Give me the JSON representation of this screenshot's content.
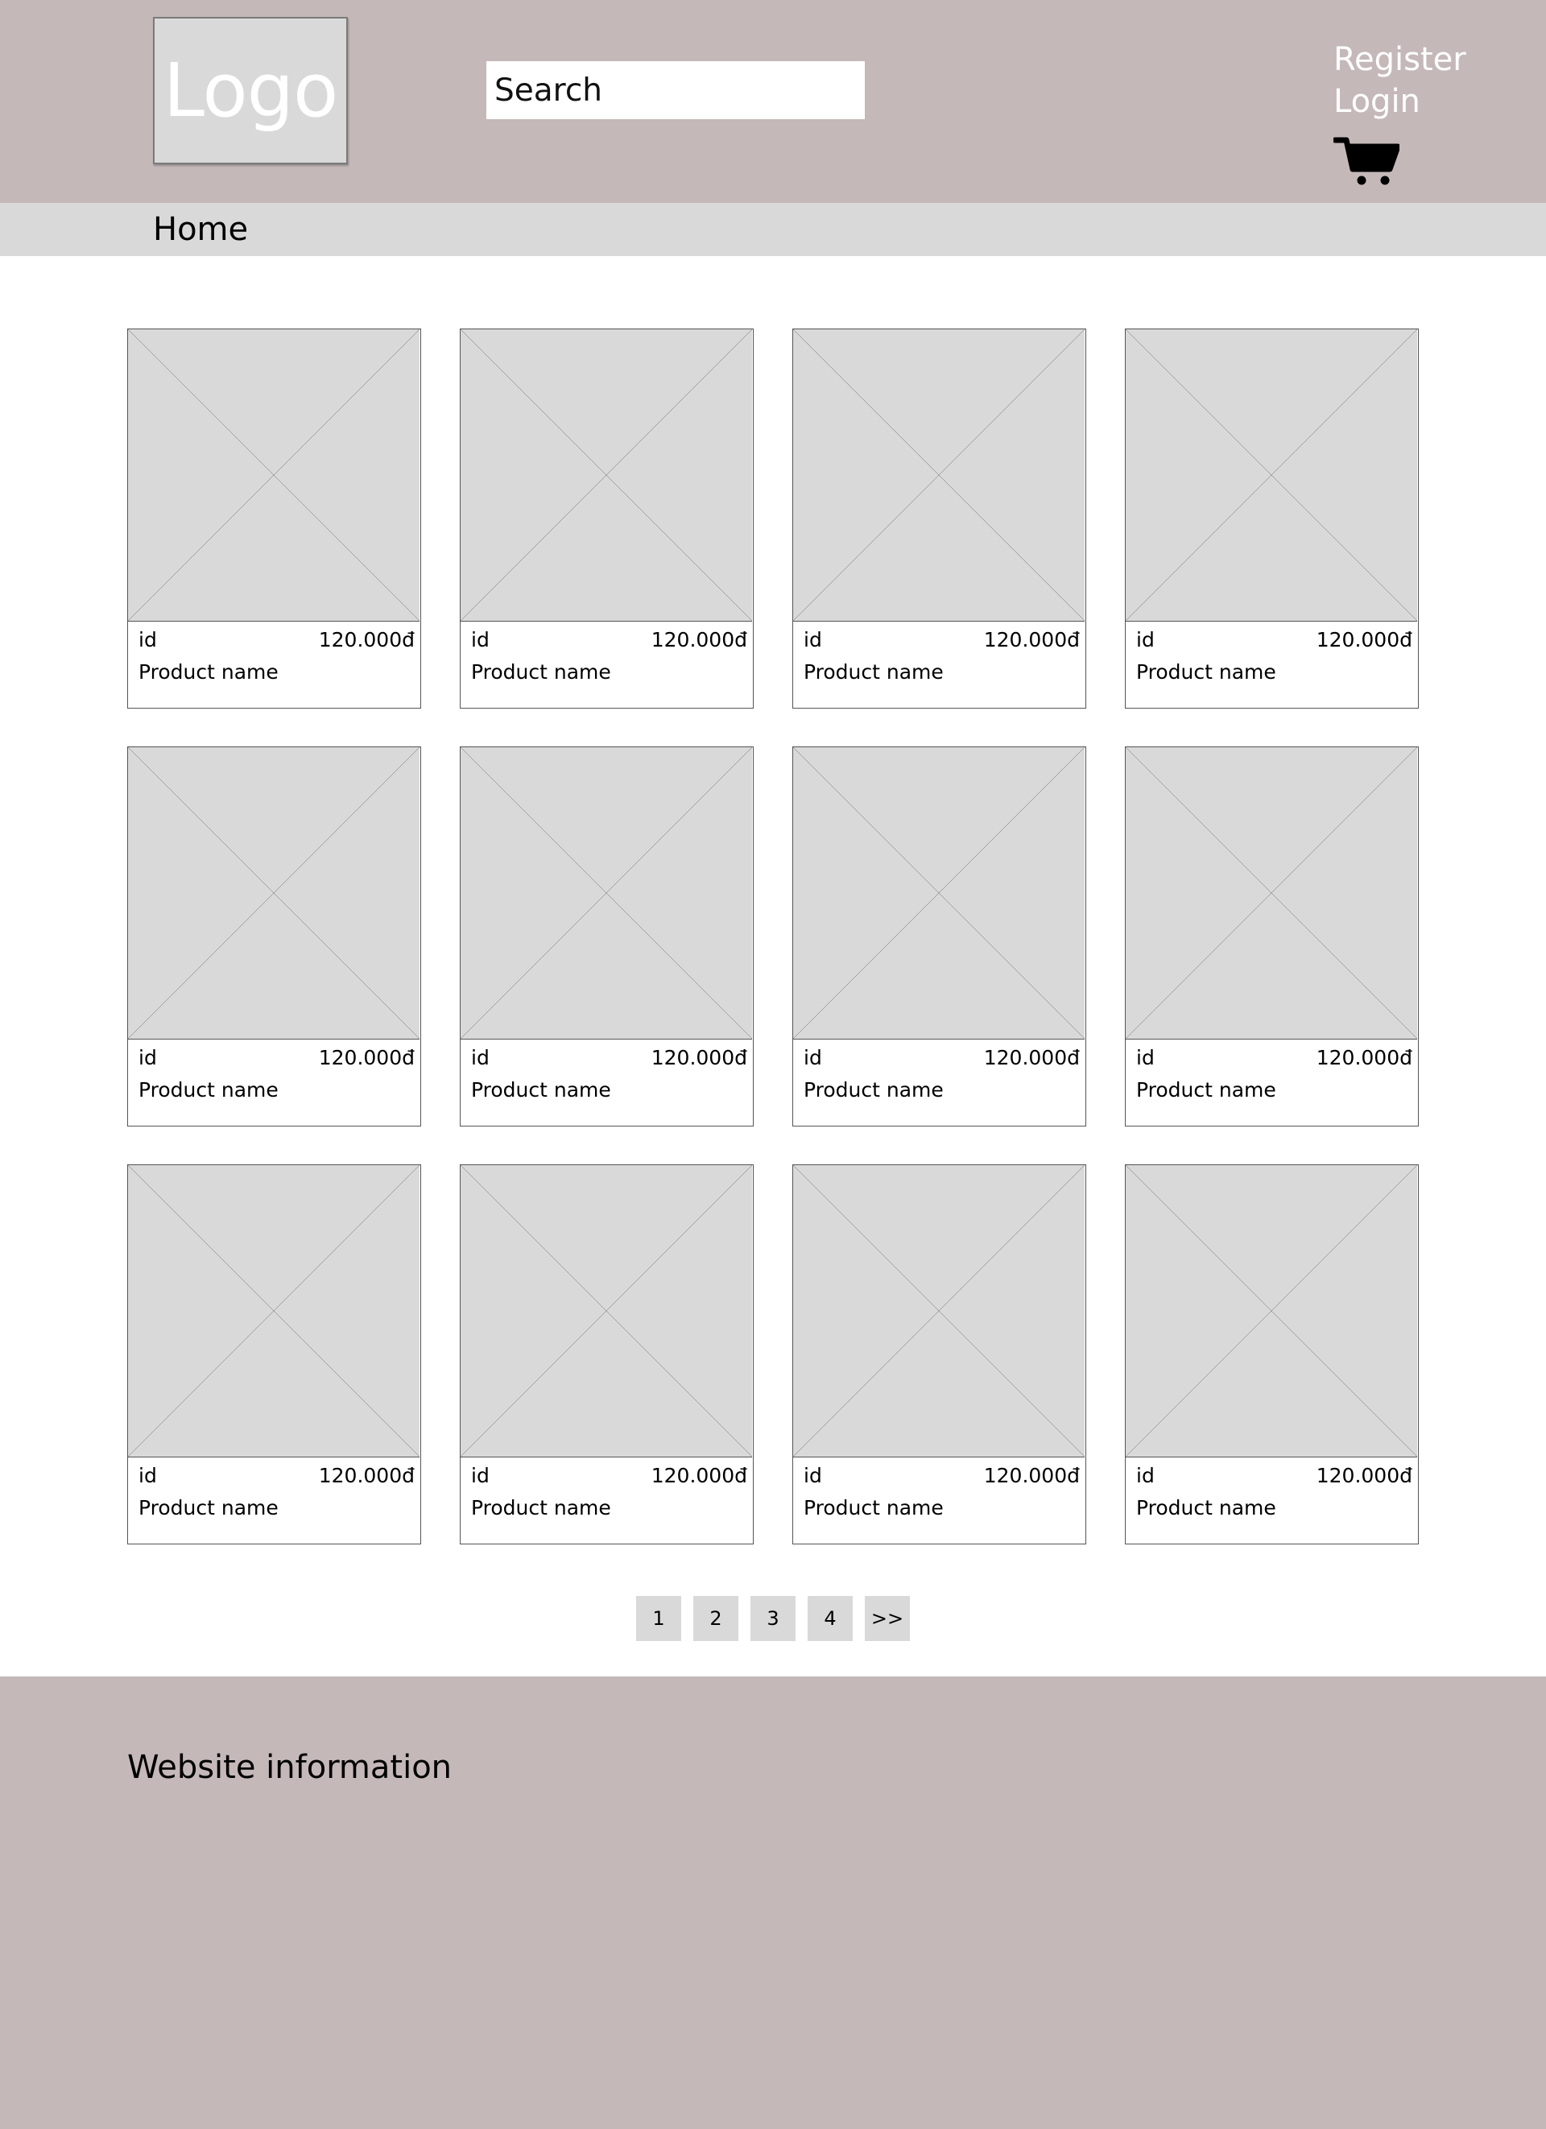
{
  "header": {
    "logo_text": "Logo",
    "search_placeholder": "Search",
    "register_label": "Register",
    "login_label": "Login",
    "cart_icon": "cart-icon"
  },
  "nav": {
    "home_label": "Home"
  },
  "products": [
    {
      "id": "id",
      "price": "120.000đ",
      "name": "Product name"
    },
    {
      "id": "id",
      "price": "120.000đ",
      "name": "Product name"
    },
    {
      "id": "id",
      "price": "120.000đ",
      "name": "Product name"
    },
    {
      "id": "id",
      "price": "120.000đ",
      "name": "Product name"
    },
    {
      "id": "id",
      "price": "120.000đ",
      "name": "Product name"
    },
    {
      "id": "id",
      "price": "120.000đ",
      "name": "Product name"
    },
    {
      "id": "id",
      "price": "120.000đ",
      "name": "Product name"
    },
    {
      "id": "id",
      "price": "120.000đ",
      "name": "Product name"
    },
    {
      "id": "id",
      "price": "120.000đ",
      "name": "Product name"
    },
    {
      "id": "id",
      "price": "120.000đ",
      "name": "Product name"
    },
    {
      "id": "id",
      "price": "120.000đ",
      "name": "Product name"
    },
    {
      "id": "id",
      "price": "120.000đ",
      "name": "Product name"
    }
  ],
  "pagination": {
    "pages": [
      "1",
      "2",
      "3",
      "4"
    ],
    "next_label": ">>"
  },
  "footer": {
    "title": "Website information"
  },
  "colors": {
    "header_bg": "#c4b9b8",
    "nav_bg": "#d9d9d9",
    "placeholder_bg": "#d9d9d9",
    "footer_bg": "#c4b9b8"
  }
}
